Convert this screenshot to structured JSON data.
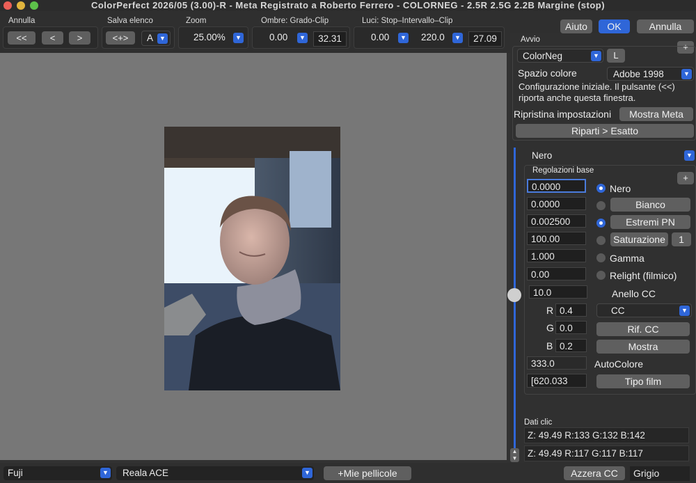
{
  "window": {
    "title": "ColorPerfect 2026/05 (3.00)-R -  Meta Registrato a Roberto Ferrero - COLORNEG - 2.5R 2.5G 2.2B Margine (stop)"
  },
  "toolbar": {
    "annulla_group": {
      "label": "Annulla",
      "first": "<<",
      "prev": "<",
      "next": ">"
    },
    "salva": {
      "label": "Salva elenco",
      "button": "<+>",
      "selected": "A"
    },
    "zoom": {
      "label": "Zoom",
      "value": "25.00%"
    },
    "ombre": {
      "label": "Ombre: Grado-Clip",
      "grade": "0.00",
      "clip": "32.31"
    },
    "luci": {
      "label": "Luci: Stop–Intervallo–Clip",
      "stop": "0.00",
      "range": "220.0",
      "clip": "27.09"
    },
    "aiuto": "Aiuto",
    "ok": "OK",
    "annulla": "Annulla"
  },
  "avvio": {
    "title": "Avvio",
    "plus": "+",
    "mode": "ColorNeg",
    "l_button": "L",
    "colorspace_label": "Spazio colore",
    "colorspace_value": "Adobe 1998",
    "info": "Configurazione iniziale. Il pulsante (<<) riporta anche questa finestra.",
    "ripristina_label": "Ripristina impostazioni",
    "mostra_meta": "Mostra Meta",
    "riparti": "Riparti > Esatto"
  },
  "regolazioni": {
    "preset": "Nero",
    "title": "Regolazioni base",
    "plus": "+",
    "fields": [
      "0.0000",
      "0.0000",
      "0.002500",
      "100.00",
      "1.000",
      "0.00",
      "10.0"
    ],
    "nero": "Nero",
    "bianco": "Bianco",
    "estremi": "Estremi PN",
    "saturazione": "Saturazione",
    "saturazione_num": "1",
    "gamma": "Gamma",
    "relight": "Relight (filmico)",
    "anello": "Anello CC",
    "r_label": "R",
    "r_value": "0.4",
    "g_label": "G",
    "g_value": "0.0",
    "b_label": "B",
    "b_value": "0.2",
    "cc_select": "CC",
    "rif_cc": "Rif. CC",
    "mostra": "Mostra",
    "autocolore_value": "333.0",
    "autocolore": "AutoColore",
    "tipo_value": "[620.033",
    "tipo_film": "Tipo film"
  },
  "dati_clic": {
    "title": "Dati clic",
    "row1": "Z:  49.49  R:133 G:132 B:142",
    "row2": "Z:  49.49 R:117 G:117 B:117"
  },
  "bottom": {
    "film_brand": "Fuji",
    "film_type": "Reala ACE",
    "mie_pellicole": "+Mie pellicole",
    "azzera_cc": "Azzera CC",
    "grigio": "Grigio"
  },
  "colors": {
    "accent": "#2f66d8",
    "preview_bg": "#777777",
    "panel_bg": "#303030"
  }
}
